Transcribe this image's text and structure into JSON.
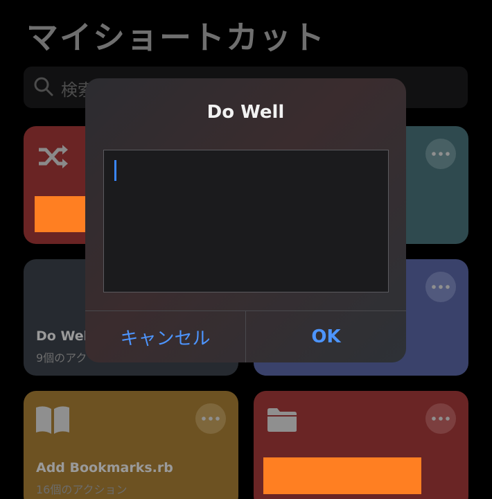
{
  "header": {
    "title": "マイショートカット"
  },
  "search": {
    "placeholder": "検索"
  },
  "cards": [
    {
      "name": "",
      "actions": "",
      "icon": "shuffle-icon",
      "color": "#6a2424"
    },
    {
      "name": "",
      "actions": "",
      "icon": "",
      "color": "#2f4a4f"
    },
    {
      "name": "Do Wel",
      "actions": "9個のアク",
      "icon": "",
      "color": "#262a30"
    },
    {
      "name": "",
      "actions": "",
      "icon": "",
      "color": "#3a426b"
    },
    {
      "name": "Add Bookmarks.rb",
      "actions": "16個のアクション",
      "icon": "book-icon",
      "color": "#6d5222"
    },
    {
      "name": "",
      "actions": "",
      "icon": "folder-icon",
      "color": "#6a2525"
    }
  ],
  "redaction_color": "#ff7f22",
  "dialog": {
    "title": "Do Well",
    "input_value": "",
    "cancel_label": "キャンセル",
    "ok_label": "OK",
    "accent_color": "#4d95ff"
  }
}
